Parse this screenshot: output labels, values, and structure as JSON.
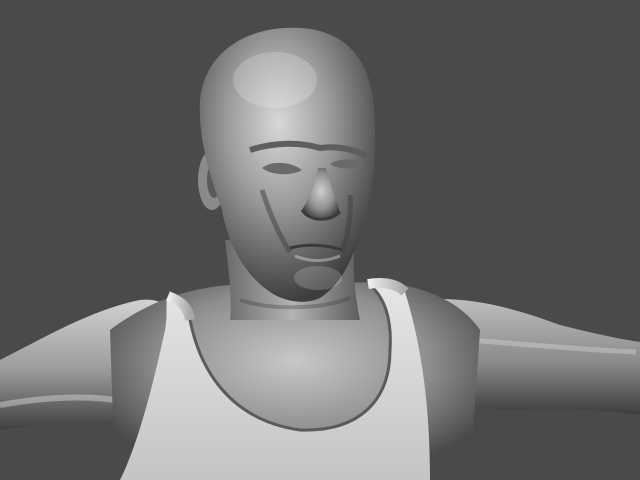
{
  "scene": {
    "background_color": "#4a4a4a",
    "material": "grey-clay",
    "subject": "male-bust-model",
    "clothing": "tank-top",
    "pose": "t-pose"
  },
  "colors": {
    "skin_light": "#d6d6d6",
    "skin_mid": "#9a9a9a",
    "skin_dark": "#3a3a3a",
    "shirt_light": "#e8e8e8",
    "shirt_dark": "#8a8a8a"
  }
}
